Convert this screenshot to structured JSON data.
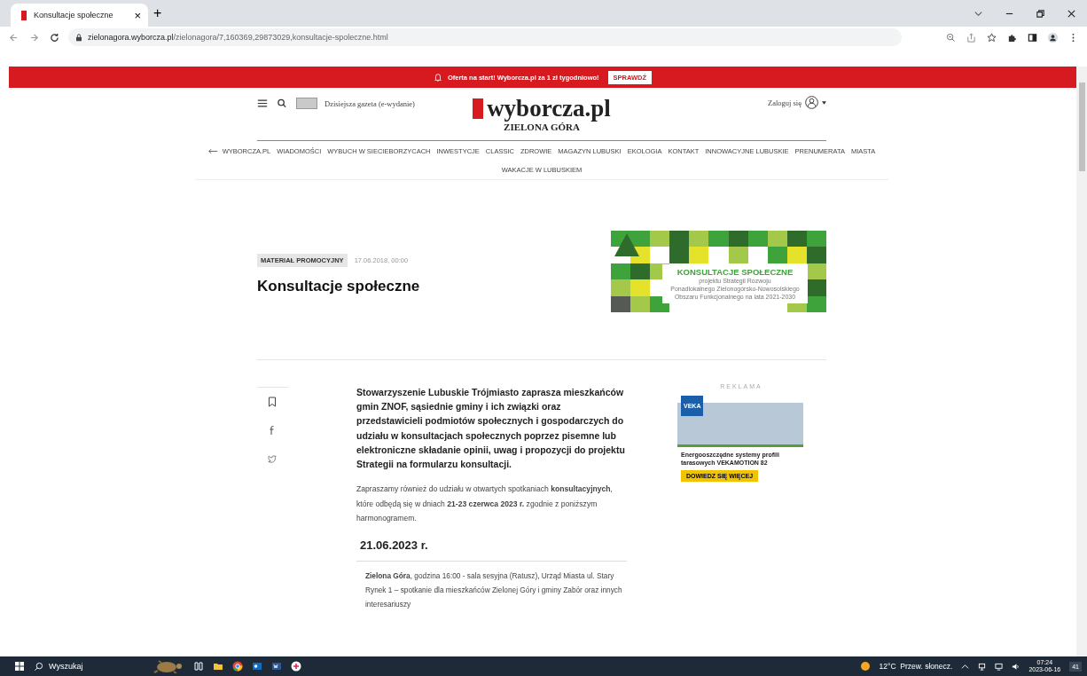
{
  "browser": {
    "tab": {
      "title": "Konsultacje społeczne",
      "close": "×"
    },
    "new_tab": "+",
    "url_host": "zielonagora.wyborcza.pl",
    "url_path": "/zielonagora/7,160369,29873029,konsultacje-spoleczne.html"
  },
  "promo_bar": {
    "text": "Oferta na start! Wyborcza.pl za 1 zł tygodniowo!",
    "button": "SPRAWDŹ"
  },
  "header": {
    "edition_link": "Dzisiejsza gazeta (e-wydanie)",
    "logo": "wyborcza.pl",
    "city": "ZIELONA GÓRA",
    "login": "Zaloguj się"
  },
  "nav": {
    "items": [
      {
        "label": "WYBORCZA.PL",
        "kind": "back"
      },
      {
        "label": "WIADOMOŚCI",
        "kind": "link"
      },
      {
        "label": "WYBUCH W SIECIEBORZYCACH",
        "kind": "link"
      },
      {
        "label": "INWESTYCJE",
        "kind": "link"
      },
      {
        "label": "CLASSIC",
        "kind": "link"
      },
      {
        "label": "ZDROWIE",
        "kind": "link"
      },
      {
        "label": "MAGAZYN LUBUSKI",
        "kind": "link"
      },
      {
        "label": "EKOLOGIA",
        "kind": "link"
      },
      {
        "label": "KONTAKT",
        "kind": "link"
      },
      {
        "label": "INNOWACYJNE LUBUSKIE",
        "kind": "link"
      },
      {
        "label": "PRENUMERATA",
        "kind": "link"
      },
      {
        "label": "MIASTA",
        "kind": "link"
      },
      {
        "label": "WAKACJE W LUBUSKIEM",
        "kind": "link"
      }
    ]
  },
  "article": {
    "tag": "MATERIAŁ PROMOCYJNY",
    "date": "17.06.2018, 00:00",
    "title": "Konsultacje społeczne",
    "banner": {
      "title": "KONSULTACJE SPOŁECZNE",
      "lines": [
        "projektu Strategii Rozwoju",
        "Ponadlokalnego Zielonogórsko-Nowosolskiego",
        "Obszaru Funkcjonalnego na lata 2021-2030"
      ]
    },
    "lead": "Stowarzyszenie Lubuskie Trójmiasto zaprasza mieszkańców gmin ZNOF, sąsiednie gminy i ich związki oraz przedstawicieli podmiotów społecznych i gospodarczych do udziału w konsultacjach społecznych poprzez pisemne lub elektroniczne składanie opinii, uwag i propozycji do projektu Strategii na formularzu konsultacji.",
    "paragraph": "Zapraszamy również do udziału w otwartych spotkaniach **konsultacyjnych**, które odbędą się w dniach **21-23 czerwca 2023 r.** zgodnie z poniższym harmonogramem.",
    "date_heading": "21.06.2023 r.",
    "schedule": [
      "**Zielona Góra**, godzina 16:00 - sala sesyjna (Ratusz), Urząd Miasta ul. Stary Rynek 1 – spotkanie dla mieszkańców Zielonej Góry i gminy Zabór oraz innych interesariuszy"
    ]
  },
  "ad": {
    "label": "REKLAMA",
    "logo": "VEKA",
    "text": "Energooszczędne systemy profili tarasowych VEKAMOTION 82",
    "button": "DOWIEDZ SIĘ WIĘCEJ"
  },
  "taskbar": {
    "search": "Wyszukaj",
    "weather": "12°C  Przew. słonecz.",
    "time": "07:24",
    "date": "2023-06-16",
    "notifications": "41"
  }
}
